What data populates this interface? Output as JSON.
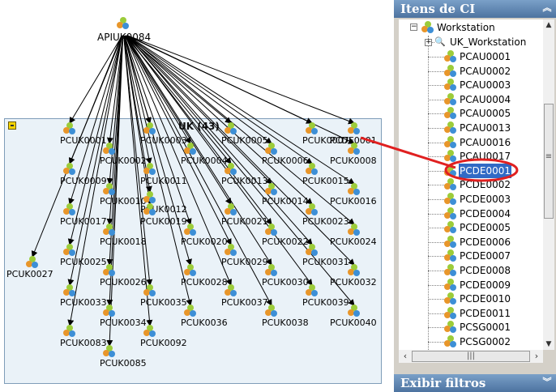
{
  "diagram": {
    "root_label": "APIUK0084",
    "group_title": "UK (43)",
    "nodes": [
      "PCUK0001",
      "PCUK0003",
      "PCUK0005",
      "PCUK0007",
      "PCDE0001",
      "PCUK0002",
      "PCUK0004",
      "PCUK0006",
      "PCUK0008",
      "PCUK0009",
      "PCUK0011",
      "PCUK0013",
      "PCUK0015",
      "PCUK0010",
      "PCUK0012",
      "PCUK0014",
      "PCUK0016",
      "PCUK0017",
      "PCUK0019",
      "PCUK0021",
      "PCUK0023",
      "PCUK0018",
      "PCUK0020",
      "PCUK0022",
      "PCUK0024",
      "PCUK0025",
      "PCUK0027",
      "PCUK0029",
      "PCUK0031",
      "PCUK0026",
      "PCUK0028",
      "PCUK0030",
      "PCUK0032",
      "PCUK0033",
      "PCUK0035",
      "PCUK0037",
      "PCUK0039",
      "PCUK0034",
      "PCUK0036",
      "PCUK0038",
      "PCUK0040",
      "PCUK0083",
      "PCUK0092",
      "PCUK0085"
    ]
  },
  "panel": {
    "title": "Itens de CI",
    "footer": "Exibir filtros",
    "header_icon": "double-chevron-up-icon",
    "footer_icon": "double-chevron-down-icon",
    "tree": {
      "parent": "Workstation",
      "group": "UK_Workstation",
      "items": [
        "PCAU0001",
        "PCAU0002",
        "PCAU0003",
        "PCAU0004",
        "PCAU0005",
        "PCAU0013",
        "PCAU0016",
        "PCAU0017",
        "PCDE0001",
        "PCDE0002",
        "PCDE0003",
        "PCDE0004",
        "PCDE0005",
        "PCDE0006",
        "PCDE0007",
        "PCDE0008",
        "PCDE0009",
        "PCDE0010",
        "PCDE0011",
        "PCSG0001",
        "PCSG0002"
      ],
      "selected": "PCDE0001"
    }
  },
  "colors": {
    "selection": "#316ac5",
    "annotation": "#e02020",
    "group_background": "#eaf2f8"
  }
}
